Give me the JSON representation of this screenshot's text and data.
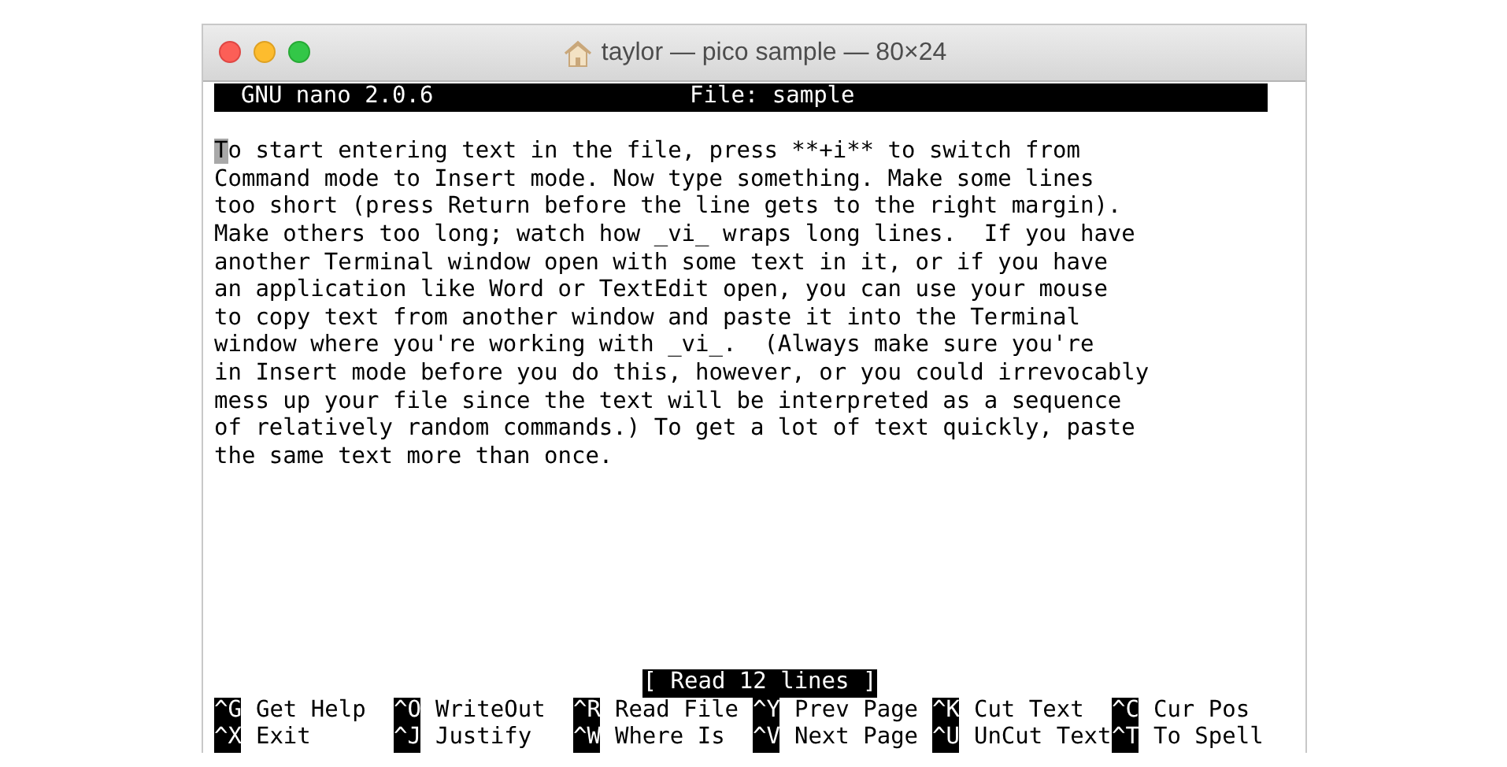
{
  "window": {
    "title": "taylor — pico sample — 80×24"
  },
  "header": {
    "app": "GNU nano 2.0.6",
    "file": "File: sample"
  },
  "lines": [
    {
      "cursor": "T",
      "text": "o start entering text in the file, press **+i** to switch from"
    },
    {
      "text": "Command mode to Insert mode. Now type something. Make some lines"
    },
    {
      "text": "too short (press Return before the line gets to the right margin)."
    },
    {
      "text": "Make others too long; watch how _vi_ wraps long lines.  If you have"
    },
    {
      "text": "another Terminal window open with some text in it, or if you have"
    },
    {
      "text": "an application like Word or TextEdit open, you can use your mouse"
    },
    {
      "text": "to copy text from another window and paste it into the Terminal"
    },
    {
      "text": "window where you're working with _vi_.  (Always make sure you're"
    },
    {
      "text": "in Insert mode before you do this, however, or you could irrevocably"
    },
    {
      "text": "mess up your file since the text will be interpreted as a sequence"
    },
    {
      "text": "of relatively random commands.) To get a lot of text quickly, paste"
    },
    {
      "text": "the same text more than once."
    }
  ],
  "status": "[ Read 12 lines ]",
  "shortcuts": [
    [
      {
        "key": "^G",
        "label": "Get Help"
      },
      {
        "key": "^O",
        "label": "WriteOut"
      },
      {
        "key": "^R",
        "label": "Read File"
      },
      {
        "key": "^Y",
        "label": "Prev Page"
      },
      {
        "key": "^K",
        "label": "Cut Text"
      },
      {
        "key": "^C",
        "label": "Cur Pos"
      }
    ],
    [
      {
        "key": "^X",
        "label": "Exit"
      },
      {
        "key": "^J",
        "label": "Justify"
      },
      {
        "key": "^W",
        "label": "Where Is"
      },
      {
        "key": "^V",
        "label": "Next Page"
      },
      {
        "key": "^U",
        "label": "UnCut Text"
      },
      {
        "key": "^T",
        "label": "To Spell"
      }
    ]
  ]
}
